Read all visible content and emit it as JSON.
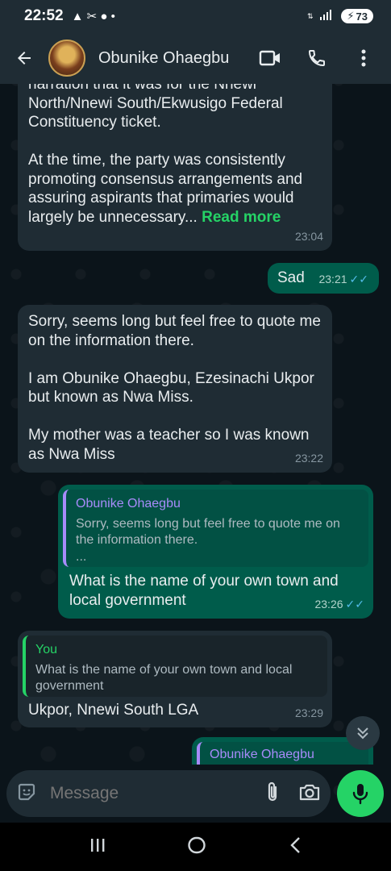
{
  "status_bar": {
    "time": "22:52",
    "left_icons": "▲ ✂ ● •",
    "battery": "73"
  },
  "header": {
    "contact_name": "Obunike Ohaegbu"
  },
  "messages": [
    {
      "direction": "incoming",
      "text": "narration that it was for the Nnewi North/Nnewi South/Ekwusigo Federal Constituency ticket.\n\nAt the time, the party was consistently promoting consensus arrangements and assuring aspirants that primaries would largely be unnecessary... ",
      "read_more": "Read more",
      "time": "23:04"
    },
    {
      "direction": "outgoing",
      "text": "Sad",
      "time": "23:21"
    },
    {
      "direction": "incoming",
      "text": "Sorry, seems long but feel free to quote me on the information there.\n\nI am Obunike Ohaegbu, Ezesinachi Ukpor but known as Nwa Miss.\n\nMy mother was a teacher so I was known as Nwa Miss",
      "time": "23:22"
    },
    {
      "direction": "outgoing",
      "quote_author": "Obunike Ohaegbu",
      "quote_text": "Sorry, seems long but feel free to quote me on the information there.\n...",
      "text": "What is the name of your own town and local government",
      "time": "23:26"
    },
    {
      "direction": "incoming",
      "quote_author": "You",
      "quote_text": "What is the name of your own town and local government",
      "text": "Ukpor, Nnewi South LGA",
      "time": "23:29"
    },
    {
      "direction": "outgoing",
      "quote_author": "Obunike Ohaegbu"
    }
  ],
  "composer": {
    "placeholder": "Message"
  },
  "colors": {
    "incoming_bubble": "#1f2c34",
    "outgoing_bubble": "#005c4b",
    "accent_green": "#25d366",
    "read_ticks": "#53bdeb"
  },
  "icons": [
    "back-arrow-icon",
    "video-call-icon",
    "phone-icon",
    "more-vert-icon",
    "chevron-double-down-icon",
    "sticker-icon",
    "attach-icon",
    "camera-icon",
    "mic-icon"
  ]
}
